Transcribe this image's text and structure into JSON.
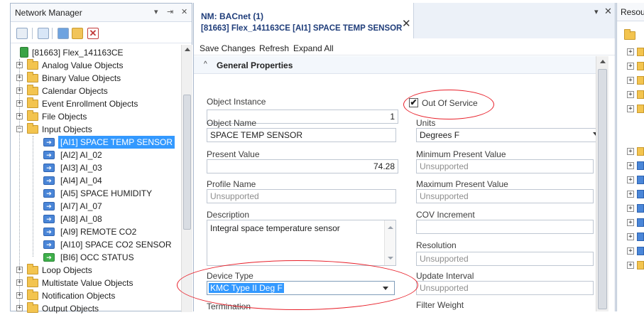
{
  "left_panel": {
    "title": "Network Manager",
    "controls": [
      "▾",
      "⇥",
      "✕"
    ],
    "tree_root": "[81663] Flex_141163CE",
    "folders_top": [
      "Analog Value Objects",
      "Binary Value Objects",
      "Calendar Objects",
      "Event Enrollment Objects",
      "File Objects",
      "Input Objects"
    ],
    "input_items": [
      "[AI1] SPACE TEMP SENSOR",
      "[AI2] AI_02",
      "[AI3] AI_03",
      "[AI4] AI_04",
      "[AI5] SPACE HUMIDITY",
      "[AI7] AI_07",
      "[AI8] AI_08",
      "[AI9] REMOTE CO2",
      "[AI10] SPACE CO2 SENSOR",
      "[BI6] OCC STATUS"
    ],
    "folders_bottom": [
      "Loop Objects",
      "Multistate Value Objects",
      "Notification Objects",
      "Output Objects"
    ]
  },
  "center_panel": {
    "tab_title_1": "NM: BACnet (1)",
    "tab_title_2": "[81663] Flex_141163CE [AI1] SPACE TEMP SENSOR",
    "tab_close": "✕",
    "window_controls": [
      "▾",
      "✕"
    ],
    "menu": [
      "Save Changes",
      "Refresh",
      "Expand All"
    ],
    "section_chevron": "^",
    "section_title": "General Properties",
    "fields": {
      "object_instance_label": "Object Instance",
      "object_instance_value": "1",
      "out_of_service_label": "Out Of Service",
      "out_of_service_check": "✔",
      "object_name_label": "Object Name",
      "object_name_value": "SPACE TEMP SENSOR",
      "units_label": "Units",
      "units_value": "Degrees F",
      "present_value_label": "Present Value",
      "present_value_value": "74.28",
      "min_present_label": "Minimum Present Value",
      "min_present_value": "Unsupported",
      "profile_name_label": "Profile Name",
      "profile_name_value": "Unsupported",
      "max_present_label": "Maximum Present Value",
      "max_present_value": "Unsupported",
      "description_label": "Description",
      "description_value": "Integral space temperature sensor",
      "cov_increment_label": "COV Increment",
      "cov_increment_value": "",
      "resolution_label": "Resolution",
      "resolution_value": "Unsupported",
      "device_type_label": "Device Type",
      "device_type_value": "KMC Type II Deg F",
      "update_interval_label": "Update Interval",
      "update_interval_value": "Unsupported",
      "termination_label": "Termination",
      "filter_weight_label": "Filter Weight"
    }
  },
  "right_panel": {
    "title": "Resou"
  },
  "colors": {
    "selection": "#3399ff",
    "annotation": "#e8202a",
    "tab_title": "#1f3d7a"
  }
}
